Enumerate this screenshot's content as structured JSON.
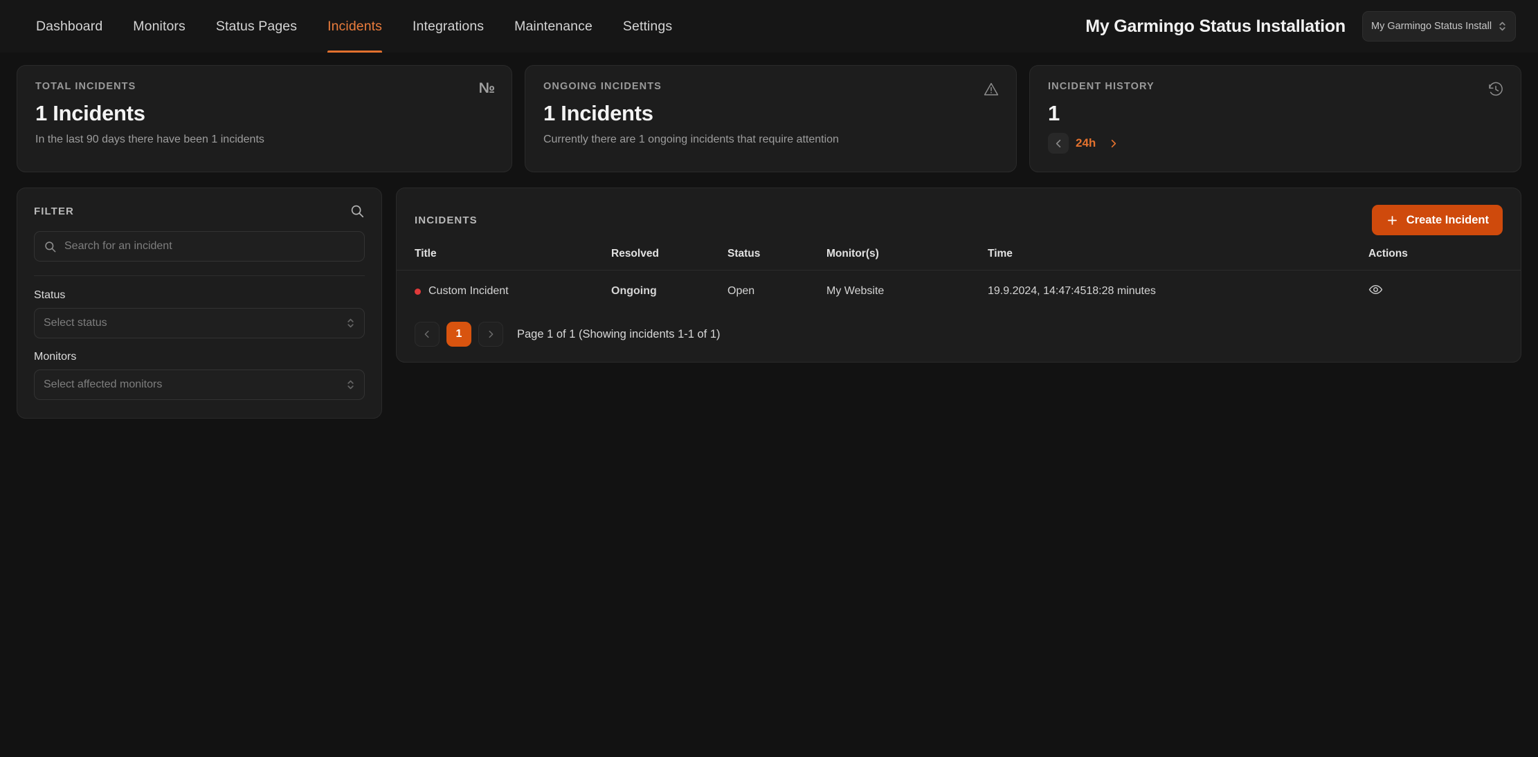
{
  "nav": {
    "items": [
      {
        "label": "Dashboard",
        "active": false
      },
      {
        "label": "Monitors",
        "active": false
      },
      {
        "label": "Status Pages",
        "active": false
      },
      {
        "label": "Incidents",
        "active": true
      },
      {
        "label": "Integrations",
        "active": false
      },
      {
        "label": "Maintenance",
        "active": false
      },
      {
        "label": "Settings",
        "active": false
      }
    ],
    "installation_title": "My Garmingo Status Installation",
    "installation_select_value": "My Garmingo Status Install"
  },
  "stats": {
    "total": {
      "kicker": "TOTAL INCIDENTS",
      "value": "1 Incidents",
      "sub": "In the last 90 days there have been 1 incidents",
      "icon": "numero-icon",
      "icon_glyph": "№"
    },
    "ongoing": {
      "kicker": "ONGOING INCIDENTS",
      "value": "1 Incidents",
      "sub": "Currently there are 1 ongoing incidents that require attention",
      "icon": "warning-triangle-icon"
    },
    "history": {
      "kicker": "INCIDENT HISTORY",
      "value": "1",
      "range": "24h",
      "icon": "history-clock-icon"
    }
  },
  "filter": {
    "title": "FILTER",
    "search_placeholder": "Search for an incident",
    "search_value": "",
    "status_label": "Status",
    "status_placeholder": "Select status",
    "monitors_label": "Monitors",
    "monitors_placeholder": "Select affected monitors"
  },
  "incidents": {
    "title": "INCIDENTS",
    "create_label": "Create Incident",
    "columns": [
      "Title",
      "Resolved",
      "Status",
      "Monitor(s)",
      "Time",
      "Actions"
    ],
    "rows": [
      {
        "title": "Custom Incident",
        "resolved": "Ongoing",
        "status": "Open",
        "monitors": "My Website",
        "time": "19.9.2024, 14:47:4518:28 minutes",
        "action_icon": "eye-icon"
      }
    ],
    "pagination": {
      "prev": "‹",
      "next": "›",
      "current_page": "1",
      "info": "Page 1 of 1 (Showing incidents 1-1 of 1)"
    }
  },
  "colors": {
    "accent": "#e2712e",
    "button": "#cf4a0c",
    "danger": "#f04545",
    "page_bg": "#121212",
    "card_bg": "#1d1d1d"
  }
}
